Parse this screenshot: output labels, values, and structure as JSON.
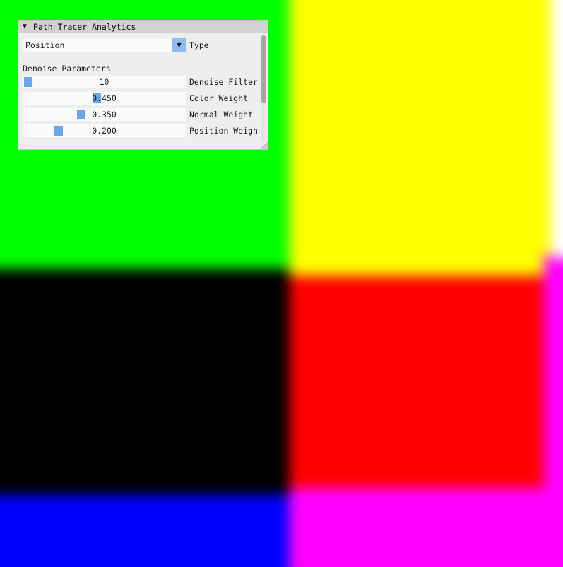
{
  "viewport": {
    "colors": {
      "top_left": "#00ff00",
      "top_right": "#ffff00",
      "middle_left": "#000000",
      "middle_right": "#ff0000",
      "bottom_left": "#0000ff",
      "bottom_right": "#ff00ff"
    }
  },
  "panel": {
    "title": "Path Tracer Analytics",
    "collapse_glyph": "▼",
    "combo": {
      "value": "Position",
      "arrow_glyph": "▼",
      "label": "Type"
    },
    "section_label": "Denoise Parameters",
    "sliders": [
      {
        "label": "Denoise Filter",
        "value": "10",
        "fraction": 0.0
      },
      {
        "label": "Color Weight",
        "value": "0.450",
        "fraction": 0.45
      },
      {
        "label": "Normal Weight",
        "value": "0.350",
        "fraction": 0.35
      },
      {
        "label": "Position Weigh",
        "value": "0.200",
        "fraction": 0.2
      }
    ],
    "accent_color": "#6aa6f0",
    "scroll_fraction": 0.0
  }
}
